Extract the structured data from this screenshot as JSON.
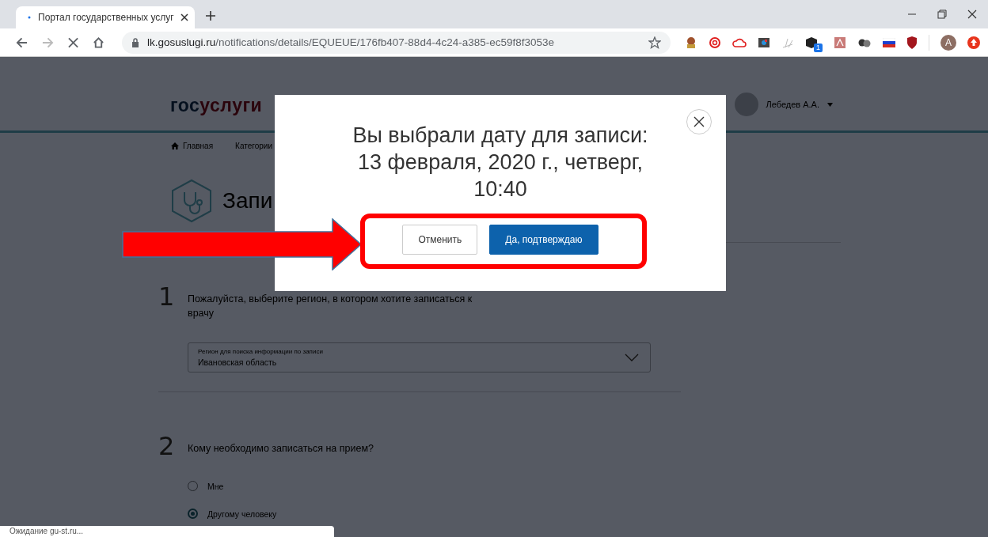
{
  "browser": {
    "tab": {
      "title": "Портал государственных услуг"
    },
    "address": {
      "host": "lk.gosuslugi.ru",
      "path": "/notifications/details/EQUEUE/176fb407-88d4-4c24-a385-ec59f8f3053e"
    },
    "extension_badge": "1",
    "profile_initial": "A",
    "status": "Ожидание gu-st.ru..."
  },
  "page": {
    "logo": [
      "гос",
      "услуги"
    ],
    "user_name": "Лебедев А.А.",
    "breadcrumbs": [
      "Главная",
      "Категории"
    ],
    "title": "Запи",
    "steps": [
      {
        "number": "1",
        "question": "Пожалуйста, выберите регион, в котором хотите записаться к врачу",
        "field": {
          "label": "Регион для поиска информации по записи",
          "value": "Ивановская область"
        }
      },
      {
        "number": "2",
        "question": "Кому необходимо записаться на прием?",
        "options": [
          {
            "label": "Мне",
            "selected": false
          },
          {
            "label": "Другому человеку",
            "selected": true
          }
        ]
      }
    ]
  },
  "modal": {
    "title": "Вы выбрали дату для записи: 13 февраля, 2020 г., четверг, 10:40",
    "buttons": [
      {
        "label": "Отменить",
        "kind": "secondary"
      },
      {
        "label": "Да, подтверждаю",
        "kind": "primary"
      }
    ]
  }
}
